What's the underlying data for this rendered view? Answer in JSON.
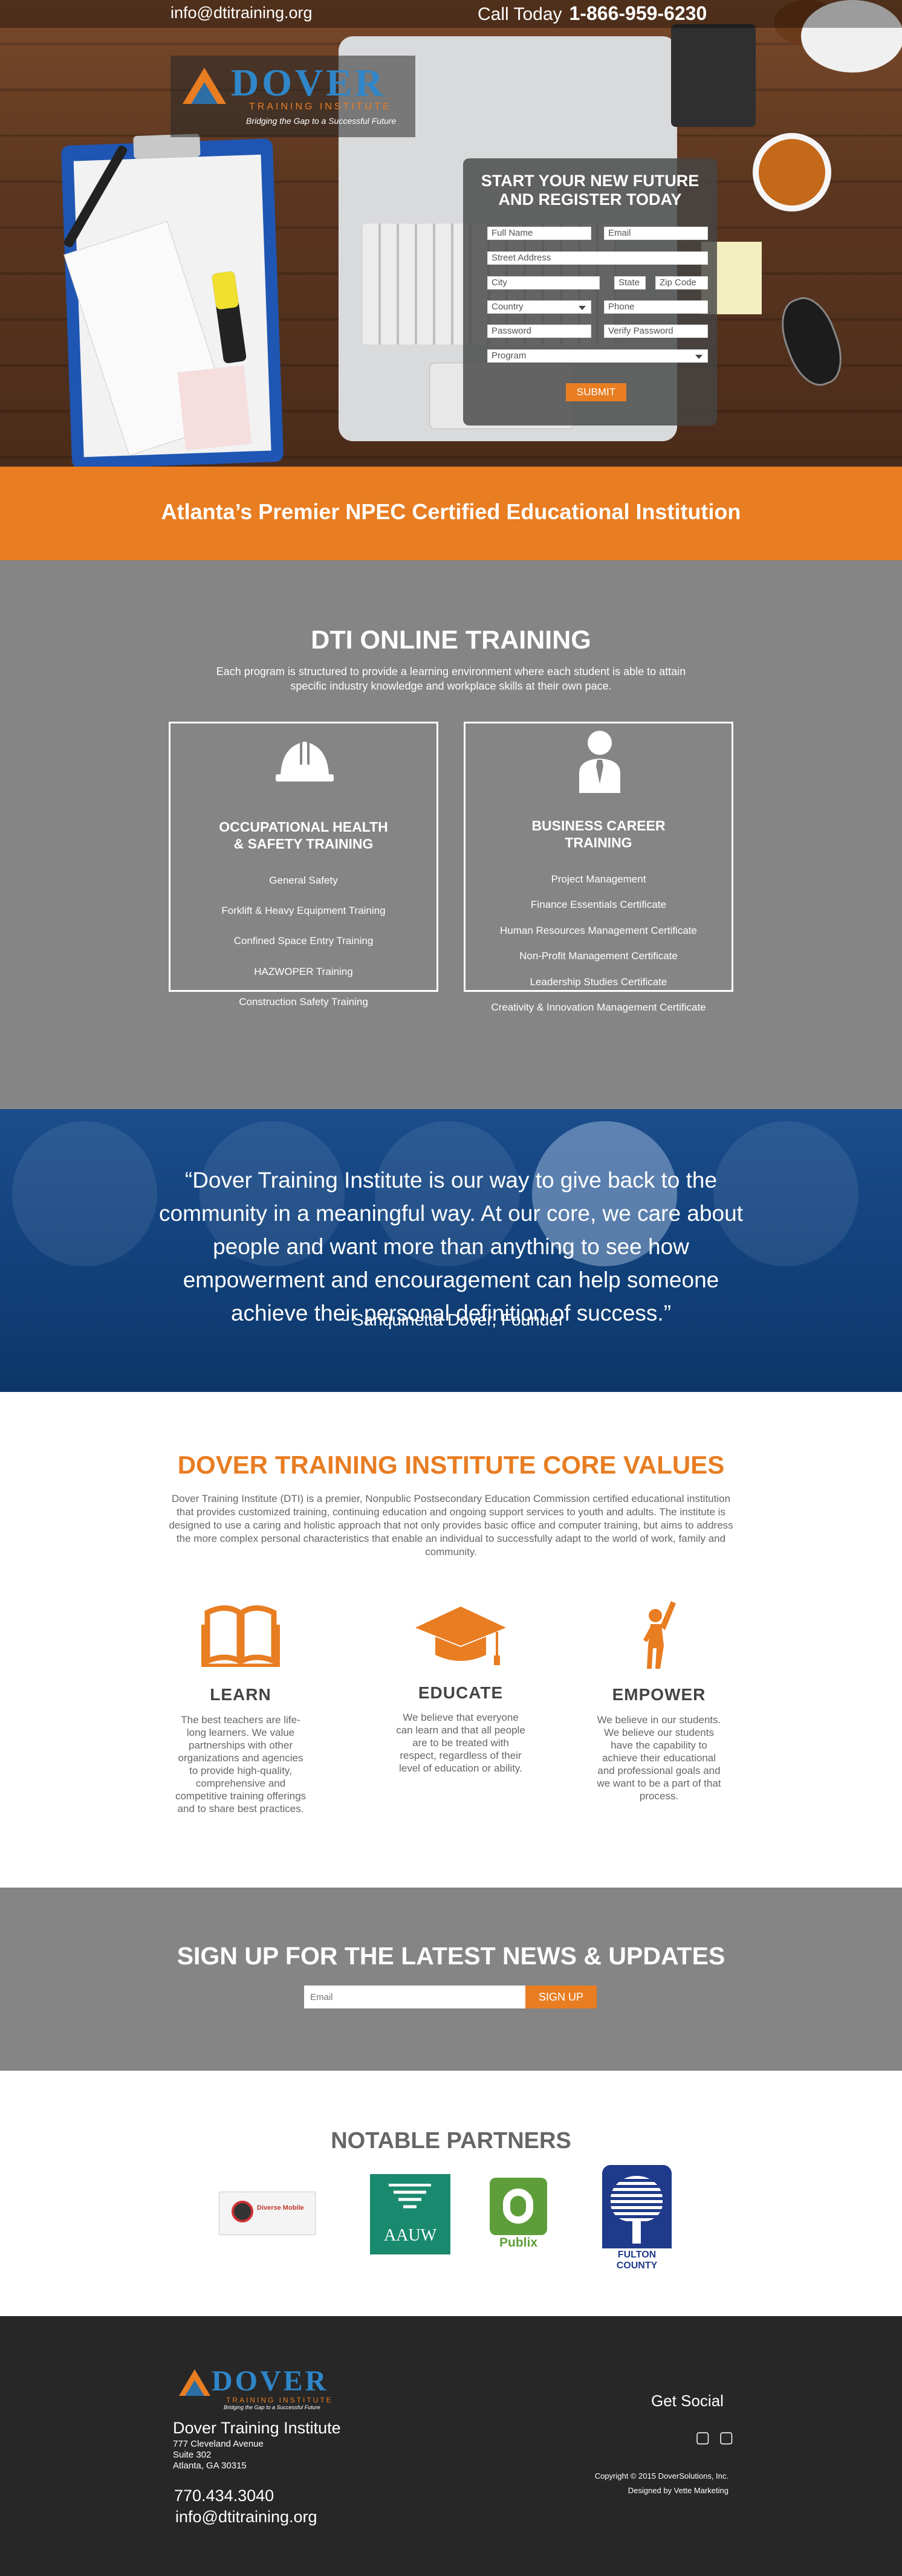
{
  "topbar": {
    "email": "info@dtitraining.org",
    "call_label": "Call Today",
    "phone": "1-866-959-6230"
  },
  "logo": {
    "name": "DOVER",
    "subtitle": "TRAINING INSTITUTE",
    "tagline": "Bridging the Gap to a Successful Future"
  },
  "register_form": {
    "title_line1": "START YOUR NEW FUTURE",
    "title_line2": "AND REGISTER TODAY",
    "full_name": "Full Name",
    "email": "Email",
    "street": "Street Address",
    "city": "City",
    "state": "State",
    "zip": "Zip Code",
    "country": "Country",
    "phone": "Phone",
    "password": "Password",
    "verify_password": "Verify Password",
    "program": "Program",
    "submit": "SUBMIT"
  },
  "banner": {
    "text": "Atlanta’s Premier NPEC Certified Educational Institution"
  },
  "online": {
    "title": "DTI ONLINE TRAINING",
    "subtitle": "Each program is structured to provide a learning environment where each student is able to attain specific industry knowledge and workplace skills at their own pace.",
    "boxes": [
      {
        "title_line1": "OCCUPATIONAL HEALTH",
        "title_line2": "& SAFETY TRAINING",
        "items": [
          "General Safety",
          "Forklift & Heavy Equipment Training",
          "Confined Space Entry Training",
          "HAZWOPER Training",
          "Construction Safety Training"
        ]
      },
      {
        "title_line1": "BUSINESS CAREER",
        "title_line2": "TRAINING",
        "items": [
          "Project Management",
          "Finance Essentials Certificate",
          "Human Resources Management Certificate",
          "Non-Profit Management Certificate",
          "Leadership Studies Certificate",
          "Creativity & Innovation Management Certificate"
        ]
      }
    ]
  },
  "quote": {
    "text": "“Dover Training Institute is our way to give back to the community in a meaningful way. At our core, we care about people and want more than anything to see how empowerment and encouragement can help someone achieve their personal definition of success.”",
    "author": "~ Sanquinetta Dover, Founder"
  },
  "core": {
    "title": "DOVER TRAINING INSTITUTE CORE VALUES",
    "intro": "Dover Training Institute (DTI) is a premier, Nonpublic Postsecondary Education Commission certified educational institution that provides customized training, continuing education and ongoing support services to youth and adults. The institute is designed to use a caring and holistic approach that not only provides basic office and computer training, but aims to address the more complex personal characteristics that enable an individual to successfully adapt to the world of work, family and community.",
    "values": [
      {
        "title": "LEARN",
        "text": "The best teachers are life-long learners. We value partnerships with other organizations and agencies to provide high-quality, comprehensive and competitive training offerings and to share best practices."
      },
      {
        "title": "EDUCATE",
        "text": "We believe that everyone can learn and that all people are to be treated with respect, regardless of their level of education or ability."
      },
      {
        "title": "EMPOWER",
        "text": "We believe in our students. We believe our students have the capability to achieve their educational and professional goals and we want to be a part of that process."
      }
    ]
  },
  "signup": {
    "title": "SIGN UP FOR THE LATEST NEWS & UPDATES",
    "placeholder": "Email",
    "button": "SIGN UP"
  },
  "partners": {
    "title": "NOTABLE PARTNERS",
    "logos": [
      "Diverse Mobile",
      "AAUW",
      "Publix",
      "FULTON COUNTY"
    ]
  },
  "footer": {
    "org": "Dover Training Institute",
    "address": [
      "777 Cleveland Avenue",
      "Suite 302",
      "Atlanta, GA  30315"
    ],
    "phone": "770.434.3040",
    "email": "info@dtitraining.org",
    "social_title": "Get Social",
    "copyright": "Copyright © 2015 DoverSolutions, Inc.",
    "designed_by": "Designed by Vette Marketing"
  },
  "colors": {
    "accent": "#e87d22",
    "gray_band": "#858585",
    "quote_blue": "#12427c",
    "footer": "#272727"
  }
}
